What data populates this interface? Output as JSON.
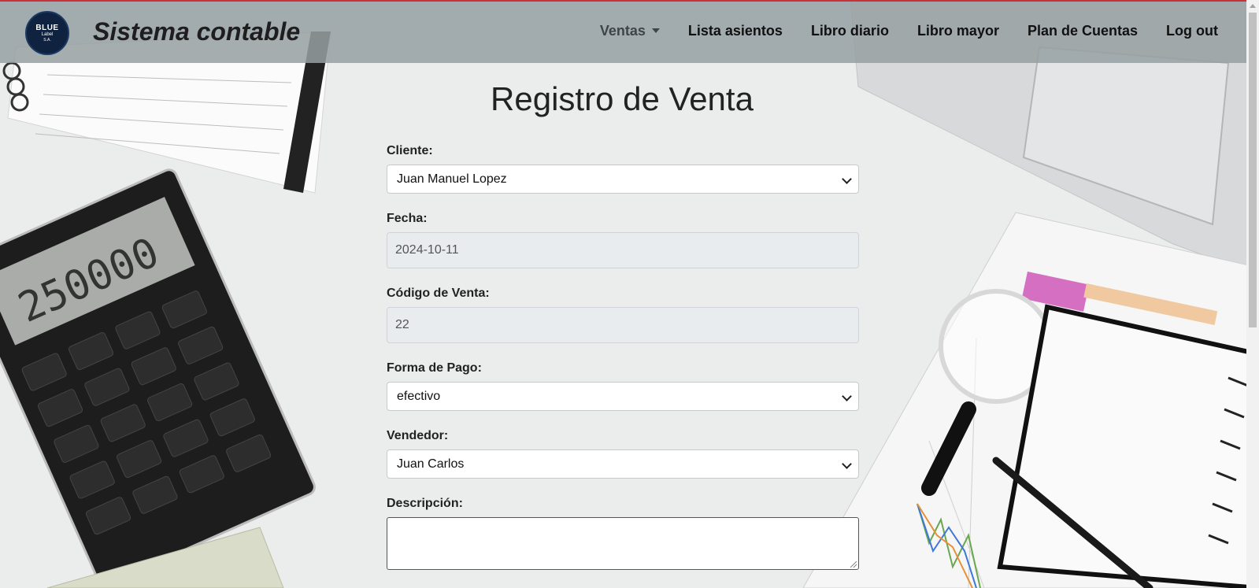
{
  "app": {
    "brand": "Sistema contable",
    "logo": {
      "line1": "BLUE",
      "line2": "Label",
      "line3": "S.A."
    }
  },
  "nav": {
    "ventas": "Ventas",
    "lista_asientos": "Lista asientos",
    "libro_diario": "Libro diario",
    "libro_mayor": "Libro mayor",
    "plan_cuentas": "Plan de Cuentas",
    "logout": "Log out"
  },
  "form": {
    "title": "Registro de Venta",
    "cliente": {
      "label": "Cliente:",
      "value": "Juan Manuel Lopez"
    },
    "fecha": {
      "label": "Fecha:",
      "value": "2024-10-11"
    },
    "codigo": {
      "label": "Código de Venta:",
      "value": "22"
    },
    "forma_pago": {
      "label": "Forma de Pago:",
      "value": "efectivo"
    },
    "vendedor": {
      "label": "Vendedor:",
      "value": "Juan Carlos"
    },
    "descripcion": {
      "label": "Descripción:",
      "value": ""
    }
  },
  "colors": {
    "navbar": "#96a0a2",
    "accent_line": "#c8313b",
    "logo_bg": "#0f2340"
  }
}
